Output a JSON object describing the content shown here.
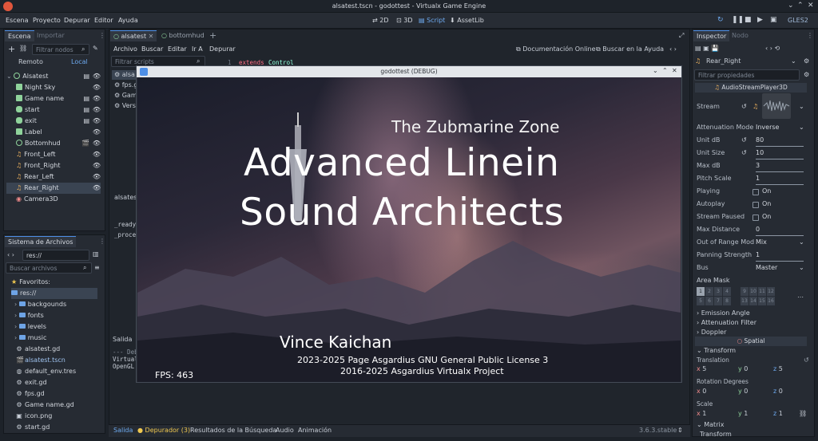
{
  "window": {
    "title": "alsatest.tscn - godottest - Virtualx Game Engine"
  },
  "menubar": {
    "items": [
      "Escena",
      "Proyecto",
      "Depurar",
      "Editor",
      "Ayuda"
    ],
    "workspaces": [
      "2D",
      "3D",
      "Script",
      "AssetLib"
    ],
    "renderer": "GLES2"
  },
  "scene_dock": {
    "tabs": [
      "Escena",
      "Importar"
    ],
    "filter_placeholder": "Filtrar nodos",
    "remote": "Remoto",
    "local": "Local",
    "nodes": [
      "Alsatest",
      "Night Sky",
      "Game name",
      "start",
      "exit",
      "Label",
      "Bottomhud",
      "Front_Left",
      "Front_Right",
      "Rear_Left",
      "Rear_Right",
      "Camera3D"
    ]
  },
  "filesystem": {
    "title": "Sistema de Archivos",
    "path": "res://",
    "search_placeholder": "Buscar archivos",
    "items": [
      "Favoritos:",
      "res://",
      "backgounds",
      "fonts",
      "levels",
      "music",
      "alsatest.gd",
      "alsatest.tscn",
      "default_env.tres",
      "exit.gd",
      "fps.gd",
      "Game name.gd",
      "icon.png",
      "start.gd"
    ]
  },
  "editor_tabs": [
    "alsatest",
    "bottomhud"
  ],
  "script_menu": [
    "Archivo",
    "Buscar",
    "Editar",
    "Ir A",
    "Depurar"
  ],
  "script_toolbar": {
    "docs": "Documentación Online",
    "help": "Buscar en la Ayuda"
  },
  "script_list": {
    "filter_placeholder": "Filtrar scripts",
    "items": [
      "alsa",
      "fps.g",
      "Gam",
      "Versi"
    ]
  },
  "script_methods": {
    "title": "alsatest",
    "items": [
      "_ready",
      "_proces"
    ]
  },
  "code": {
    "line": "1",
    "keyword": "extends",
    "class": "Control"
  },
  "output": {
    "title": "Salida",
    "lines": [
      "--- Deb",
      "Virtual",
      "OpenGL"
    ]
  },
  "bottom_tabs": [
    "Salida",
    "Depurador (3)",
    "Resultados de la Búsqueda",
    "Audio",
    "Animación"
  ],
  "version": "3.6.3.stable",
  "game": {
    "title": "godottest (DEBUG)",
    "subtitle": "The Zubmarine Zone",
    "main_line1": "Advanced Linein",
    "main_line2": "Sound Architects",
    "author": "Vince Kaichan",
    "license1": "2023-2025 Page Asgardius GNU General Public License 3",
    "license2": "2016-2025 Asgardius Virtualx Project",
    "fps": "FPS: 463"
  },
  "inspector": {
    "tabs": [
      "Inspector",
      "Nodo"
    ],
    "node": "Rear_Right",
    "filter_placeholder": "Filtrar propiedades",
    "class": "AudioStreamPlayer3D",
    "props": [
      {
        "label": "Stream",
        "value": ""
      },
      {
        "label": "Attenuation Mode",
        "value": "Inverse"
      },
      {
        "label": "Unit dB",
        "value": "80"
      },
      {
        "label": "Unit Size",
        "value": "10"
      },
      {
        "label": "Max dB",
        "value": "3"
      },
      {
        "label": "Pitch Scale",
        "value": "1"
      },
      {
        "label": "Playing",
        "value": "On"
      },
      {
        "label": "Autoplay",
        "value": "On"
      },
      {
        "label": "Stream Paused",
        "value": "On"
      },
      {
        "label": "Max Distance",
        "value": "0"
      },
      {
        "label": "Out of Range Mod",
        "value": "Mix"
      },
      {
        "label": "Panning Strength",
        "value": "1"
      },
      {
        "label": "Bus",
        "value": "Master"
      }
    ],
    "area_mask": "Area Mask",
    "mask_row1": [
      "1",
      "2",
      "3",
      "4",
      "",
      "9",
      "10",
      "11",
      "12"
    ],
    "mask_row2": [
      "5",
      "6",
      "7",
      "8",
      "",
      "13",
      "14",
      "15",
      "16"
    ],
    "groups": [
      "Emission Angle",
      "Attenuation Filter",
      "Doppler"
    ],
    "spatial": "Spatial",
    "transform": "Transform",
    "translation": {
      "label": "Translation",
      "x": "5",
      "y": "0",
      "z": "5"
    },
    "rotation": {
      "label": "Rotation Degrees",
      "x": "0",
      "y": "0",
      "z": "0"
    },
    "scale": {
      "label": "Scale",
      "x": "1",
      "y": "1",
      "z": "1"
    },
    "matrix": "Matrix",
    "matrix_transform": "Transform"
  }
}
